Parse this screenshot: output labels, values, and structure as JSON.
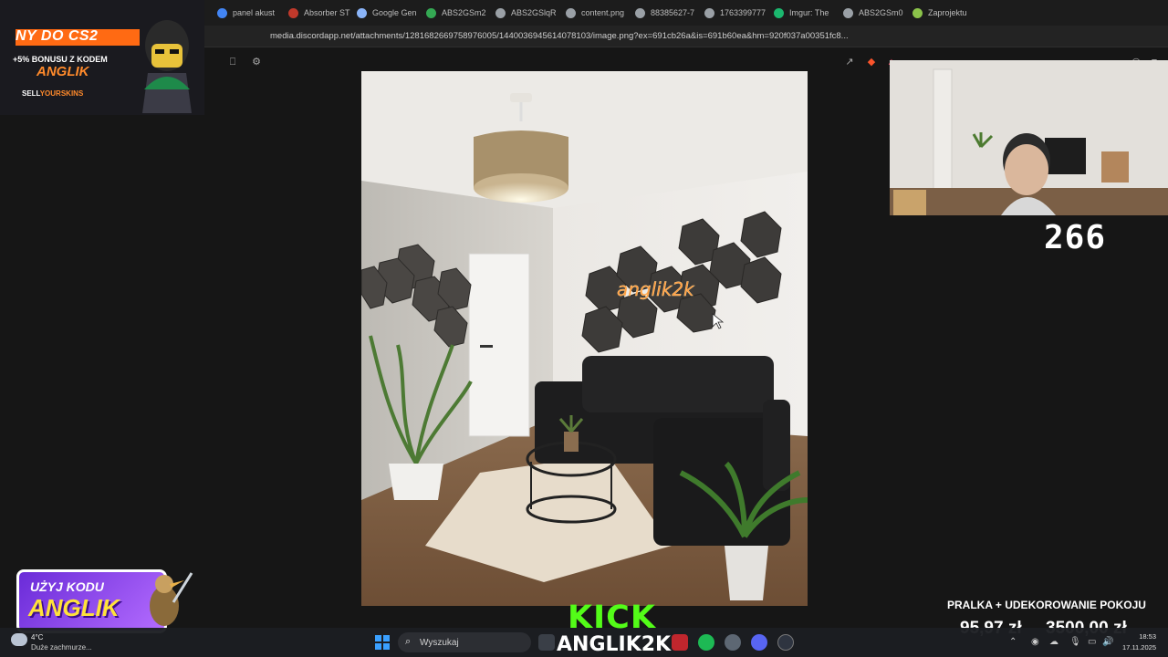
{
  "browser": {
    "tabs": [
      {
        "label": "panel akust",
        "color": "#4285f4"
      },
      {
        "label": "Absorber ST",
        "color": "#c0392b"
      },
      {
        "label": "Google Gen",
        "color": "#8ab4f8"
      },
      {
        "label": "ABS2GSm2",
        "color": "#34a853"
      },
      {
        "label": "ABS2GSlqR",
        "color": "#9aa0a6"
      },
      {
        "label": "content.png",
        "color": "#9aa0a6"
      },
      {
        "label": "88385627-7",
        "color": "#9aa0a6"
      },
      {
        "label": "1763399777",
        "color": "#9aa0a6"
      },
      {
        "label": "Imgur: The",
        "color": "#1bb76e"
      },
      {
        "label": "ABS2GSm0",
        "color": "#9aa0a6"
      },
      {
        "label": "Zaprojektu",
        "color": "#8bc34a"
      }
    ],
    "url": "media.discordapp.net/attachments/1281682669758976005/1440036945614078103/image.png?ex=691cb26a&is=691b60ea&hm=920f037a00351fc8..."
  },
  "promo": {
    "title": "NY DO CS2",
    "subtitle": "+5% BONUSU Z KODEM",
    "code": "ANGLIK",
    "brand_a": "SELL",
    "brand_b": "YOURSKINS"
  },
  "photo": {
    "neon_text": "anglik2k"
  },
  "counter": "266",
  "kodu": {
    "line1": "UŻYJ KODU",
    "line2": "ANGLIK"
  },
  "goal": {
    "title": "PRALKA + UDEKOROWANIE POKOJU",
    "current": "95,97 zł",
    "total": "3500,00 zł"
  },
  "kick": {
    "logo": "KICK",
    "name": "ANGLIK2K"
  },
  "taskbar": {
    "temp": "4°C",
    "weather": "Duże zachmurze...",
    "search_placeholder": "Wyszukaj",
    "time": "18:53",
    "date": "17.11.2025"
  }
}
